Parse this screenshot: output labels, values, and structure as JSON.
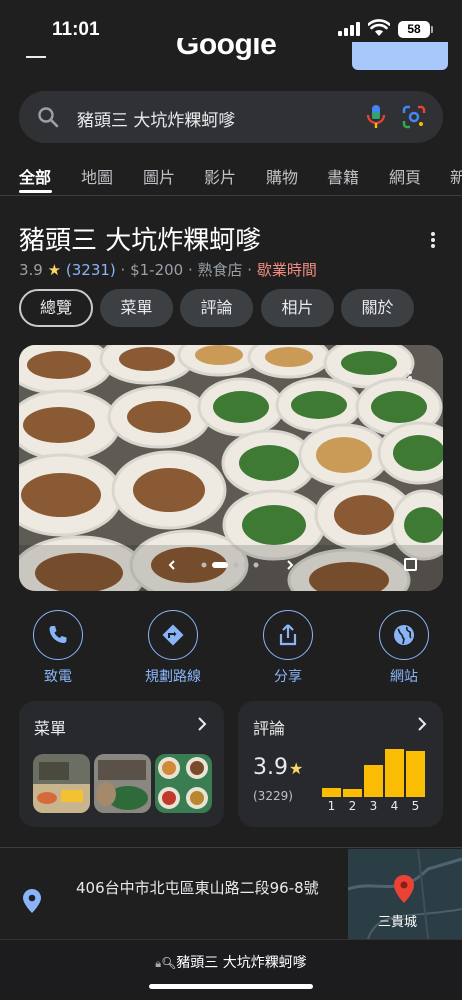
{
  "status": {
    "time": "11:01",
    "battery": "58"
  },
  "header": {
    "logo_text": "Google"
  },
  "search": {
    "query": "豬頭三 大坑炸粿蚵嗲"
  },
  "tabs": [
    "全部",
    "地圖",
    "圖片",
    "影片",
    "購物",
    "書籍",
    "網頁",
    "新"
  ],
  "business": {
    "name": "豬頭三 大坑炸粿蚵嗲",
    "rating": "3.9",
    "star": "★",
    "review_count": "(3231)",
    "price": "· $1-200 ·",
    "category": "熟食店 ·",
    "hours": "歇業時間"
  },
  "chips": [
    "總覽",
    "菜單",
    "評論",
    "相片",
    "關於"
  ],
  "actions": [
    {
      "label": "致電",
      "icon": "phone-icon"
    },
    {
      "label": "規劃路線",
      "icon": "directions-icon"
    },
    {
      "label": "分享",
      "icon": "share-icon"
    },
    {
      "label": "網站",
      "icon": "globe-icon"
    }
  ],
  "menu_card": {
    "title": "菜單"
  },
  "reviews_card": {
    "title": "評論",
    "rating": "3.9",
    "star": "★",
    "count": "(3229)",
    "distribution": [
      {
        "stars": "1",
        "share": 0.17
      },
      {
        "stars": "2",
        "share": 0.15
      },
      {
        "stars": "3",
        "share": 0.62
      },
      {
        "stars": "4",
        "share": 0.93
      },
      {
        "stars": "5",
        "share": 0.88
      }
    ]
  },
  "location": {
    "address": "406台中市北屯區東山路二段96-8號",
    "map_label": "三貴城"
  },
  "browser": {
    "url": "豬頭三 大坑炸粿蚵嗲"
  },
  "colors": {
    "accent": "#8ab4f8",
    "star": "#fdd663",
    "bar": "#fbbc04",
    "closed": "#f28b82"
  }
}
